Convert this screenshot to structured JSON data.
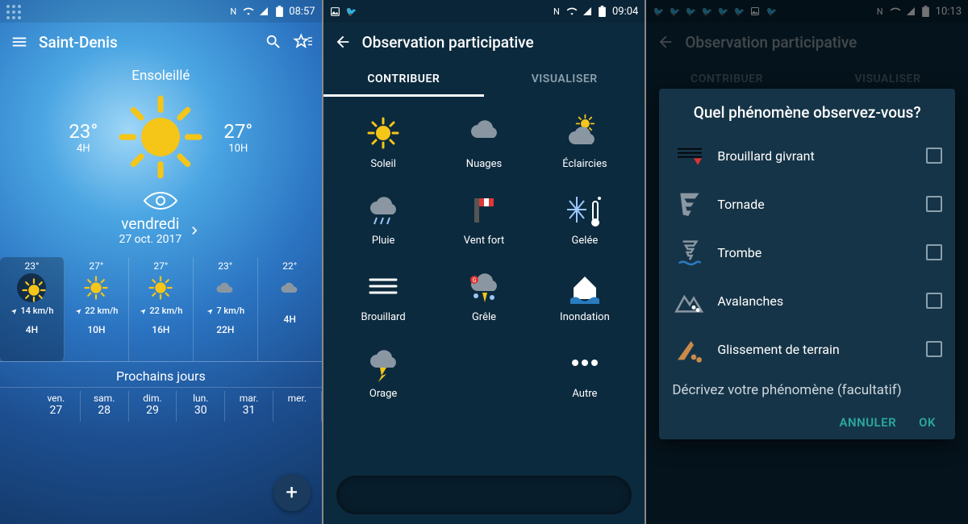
{
  "p1": {
    "status_time": "08:57",
    "city": "Saint-Denis",
    "condition": "Ensoleillé",
    "left": {
      "temp": "23°",
      "hour": "4H"
    },
    "right": {
      "temp": "27°",
      "hour": "10H"
    },
    "day": "vendredi",
    "date": "27 oct. 2017",
    "hourly": [
      {
        "t": "23°",
        "w": "14 km/h",
        "h": "4H"
      },
      {
        "t": "27°",
        "w": "22 km/h",
        "h": "10H"
      },
      {
        "t": "27°",
        "w": "22 km/h",
        "h": "16H"
      },
      {
        "t": "23°",
        "w": "7 km/h",
        "h": "22H"
      },
      {
        "t": "22°",
        "w": "",
        "h": "4H"
      }
    ],
    "next_label": "Prochains jours",
    "days": [
      {
        "n": "ven.",
        "d": "27"
      },
      {
        "n": "sam.",
        "d": "28"
      },
      {
        "n": "dim.",
        "d": "29"
      },
      {
        "n": "lun.",
        "d": "30"
      },
      {
        "n": "mar.",
        "d": "31"
      },
      {
        "n": "mer.",
        "d": ""
      }
    ]
  },
  "p2": {
    "status_time": "09:04",
    "title": "Observation participative",
    "tab1": "CONTRIBUER",
    "tab2": "VISUALISER",
    "items": [
      {
        "l": "Soleil",
        "i": "sun"
      },
      {
        "l": "Nuages",
        "i": "cloud"
      },
      {
        "l": "Éclaircies",
        "i": "sun-cloud"
      },
      {
        "l": "Pluie",
        "i": "rain"
      },
      {
        "l": "Vent fort",
        "i": "wind"
      },
      {
        "l": "Gelée",
        "i": "frost"
      },
      {
        "l": "Brouillard",
        "i": "fog"
      },
      {
        "l": "Grêle",
        "i": "hail"
      },
      {
        "l": "Inondation",
        "i": "flood"
      },
      {
        "l": "Orage",
        "i": "storm"
      },
      {
        "l": "",
        "i": ""
      },
      {
        "l": "Autre",
        "i": "more"
      }
    ]
  },
  "p3": {
    "status_time": "10:13",
    "title": "Observation participative",
    "tab1": "CONTRIBUER",
    "tab2": "VISUALISER",
    "dlg_title": "Quel phénomène observez-vous?",
    "options": [
      {
        "l": "Brouillard givrant",
        "i": "fog-ice"
      },
      {
        "l": "Tornade",
        "i": "tornado"
      },
      {
        "l": "Trombe",
        "i": "waterspout"
      },
      {
        "l": "Avalanches",
        "i": "avalanche"
      },
      {
        "l": "Glissement de terrain",
        "i": "landslide"
      }
    ],
    "sub": "Décrivez votre phénomène (facultatif)",
    "cancel": "ANNULER",
    "ok": "OK"
  }
}
